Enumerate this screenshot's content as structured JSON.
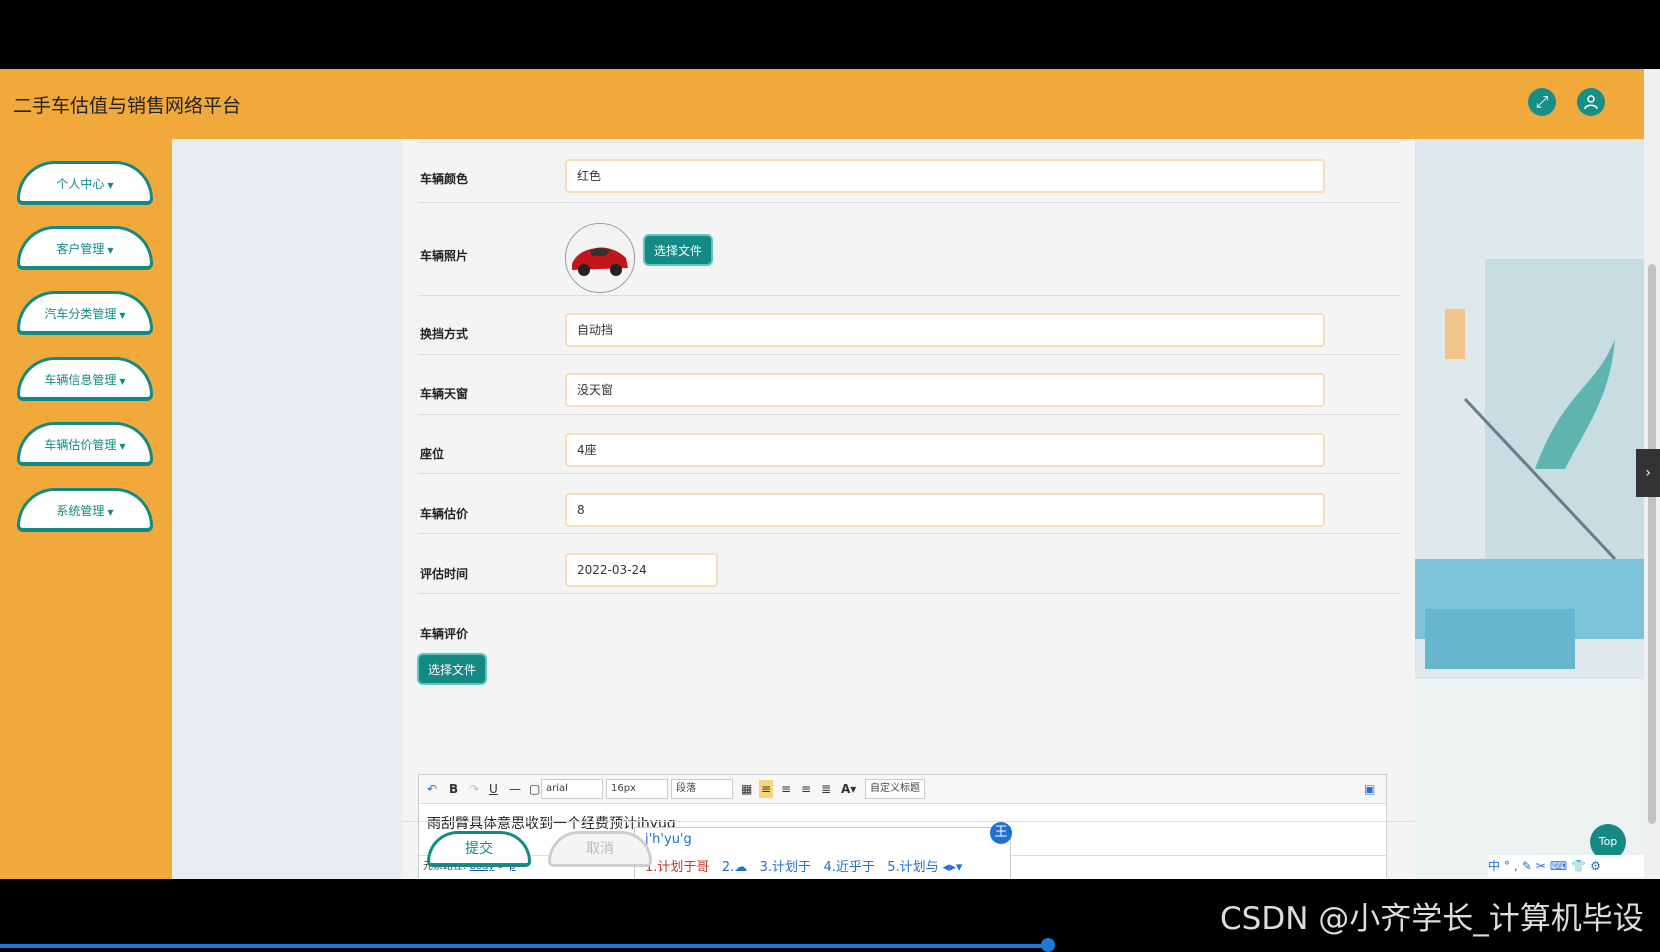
{
  "app": {
    "title": "二手车估值与销售网络平台"
  },
  "header": {
    "fullscreen_icon": "expand-icon",
    "user_icon": "user-icon"
  },
  "sidebar": {
    "items": [
      {
        "label": "个人中心"
      },
      {
        "label": "客户管理"
      },
      {
        "label": "汽车分类管理"
      },
      {
        "label": "车辆信息管理"
      },
      {
        "label": "车辆估价管理"
      },
      {
        "label": "系统管理"
      }
    ]
  },
  "form": {
    "color_label": "车辆颜色",
    "color_value": "红色",
    "photo_label": "车辆照片",
    "photo_button": "选择文件",
    "gear_label": "换挡方式",
    "gear_value": "自动挡",
    "sunroof_label": "车辆天窗",
    "sunroof_value": "没天窗",
    "seats_label": "座位",
    "seats_value": "4座",
    "price_label": "车辆估价",
    "price_value": "8",
    "date_label": "评估时间",
    "date_value": "2022-03-24",
    "review_label": "车辆评价",
    "review_button": "选择文件"
  },
  "editor": {
    "font_family": "arial",
    "font_size": "16px",
    "paragraph": "段落",
    "custom_title": "自定义标题",
    "text": "雨刮臂具体意思收到一个经费预计",
    "composition": "jhyug",
    "status_prefix": "元素路径:",
    "status_body": "body",
    "status_sep": ">",
    "status_p": "p"
  },
  "ime": {
    "pinyin": "j'h'yu'g",
    "candidates": [
      "1.计划于哥",
      "2.",
      "3.计划于",
      "4.近乎于",
      "5.计划与"
    ],
    "logo": "王"
  },
  "actions": {
    "submit": "提交",
    "cancel": "取消"
  },
  "misc": {
    "top": "Top",
    "watermark": "CSDN @小齐学长_计算机毕设",
    "tray": "中°,✎✂⌨👕⚙"
  },
  "colors": {
    "header": "#f2a93b",
    "accent": "#138a84"
  }
}
